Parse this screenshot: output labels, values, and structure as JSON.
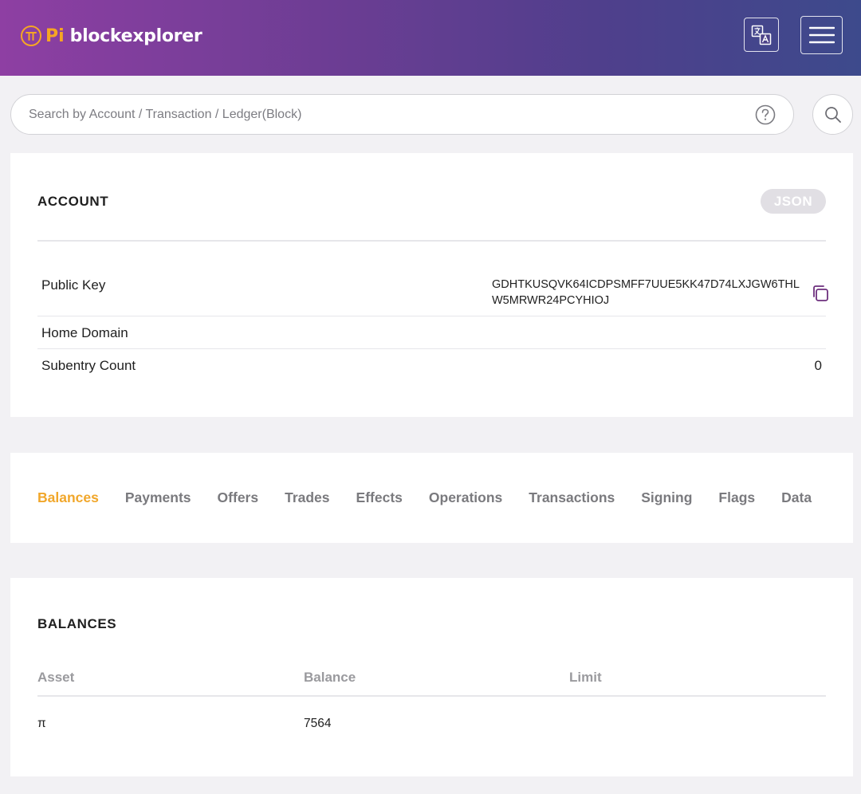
{
  "header": {
    "logo_pi": "Pi",
    "logo_text": "blockexplorer",
    "translate_icon": "translate-icon",
    "menu_icon": "hamburger-menu-icon",
    "brand_color": "#f6a623"
  },
  "search": {
    "placeholder": "Search by Account / Transaction / Ledger(Block)",
    "value": "",
    "help_icon": "question-circle-icon",
    "search_icon": "magnifier-icon"
  },
  "account": {
    "title": "ACCOUNT",
    "json_label": "JSON",
    "fields": {
      "public_key_label": "Public Key",
      "public_key_value": "GDHTKUSQVK64ICDPSMFF7UUE5KK47D74LXJGW6THLW5MRWR24PCYHIOJ",
      "home_domain_label": "Home Domain",
      "home_domain_value": "",
      "subentry_label": "Subentry Count",
      "subentry_value": "0"
    },
    "copy_icon": "copy-icon"
  },
  "tabs": {
    "active_color": "#f1a72b",
    "items": [
      {
        "label": "Balances",
        "active": true
      },
      {
        "label": "Payments"
      },
      {
        "label": "Offers"
      },
      {
        "label": "Trades"
      },
      {
        "label": "Effects"
      },
      {
        "label": "Operations"
      },
      {
        "label": "Transactions"
      },
      {
        "label": "Signing"
      },
      {
        "label": "Flags"
      },
      {
        "label": "Data"
      }
    ]
  },
  "balances": {
    "title": "BALANCES",
    "columns": [
      "Asset",
      "Balance",
      "Limit"
    ],
    "rows": [
      {
        "asset": "π",
        "balance": "7564",
        "limit": ""
      }
    ]
  }
}
